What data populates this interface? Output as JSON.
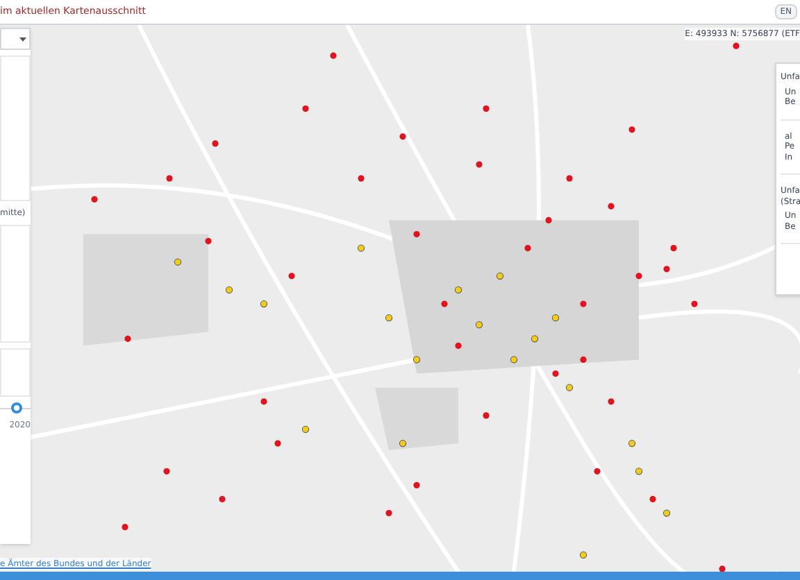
{
  "header": {
    "title": "im aktuellen Kartenausschnitt",
    "language_button": "EN"
  },
  "left_panel": {
    "section_label": "mitte)",
    "slider": {
      "level": 0.55,
      "end_label": "2020"
    }
  },
  "coordinates": "E: 493933 N: 5756877 (ETF",
  "right_panel": {
    "sections": [
      {
        "title": "Unfa",
        "lines": [
          "Un",
          "Be"
        ]
      },
      {
        "lines": [
          "al",
          "Pe",
          "In"
        ]
      },
      {
        "title": "Unfa\n(Stra",
        "lines": [
          "Un",
          "Be"
        ]
      }
    ]
  },
  "attribution": "e Ämter des Bundes und der Länder"
}
